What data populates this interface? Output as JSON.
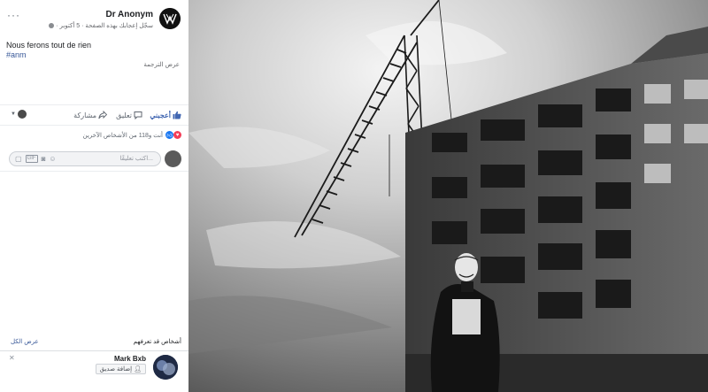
{
  "post": {
    "author": "Dr Anonym",
    "date": "5 أكتوبر",
    "meta_text": "سجّل إعجابك بهذه الصفحة",
    "text": "Nous ferons tout de rien",
    "hashtag": "#anm",
    "see_translation": "عرض الترجمة",
    "more": "···"
  },
  "actions": {
    "like": "أعجبني",
    "comment": "تعليق",
    "share": "مشاركة"
  },
  "reactions": {
    "summary": "أنت و118 من الأشخاص الآخرين"
  },
  "comment_box": {
    "placeholder": "اكتب تعليقًا..."
  },
  "people_you_may_know": {
    "title": "أشخاص قد تعرفهم",
    "see_all": "عرض الكل",
    "suggestion": {
      "name": "Mark Bxb",
      "button": "إضافة صديق"
    }
  },
  "icons": [
    "more-icon",
    "globe-icon",
    "like-icon",
    "comment-icon",
    "share-icon",
    "love-icon",
    "sticker-icon",
    "gif-icon",
    "camera-icon",
    "emoji-icon",
    "close-icon",
    "add-friend-icon"
  ]
}
